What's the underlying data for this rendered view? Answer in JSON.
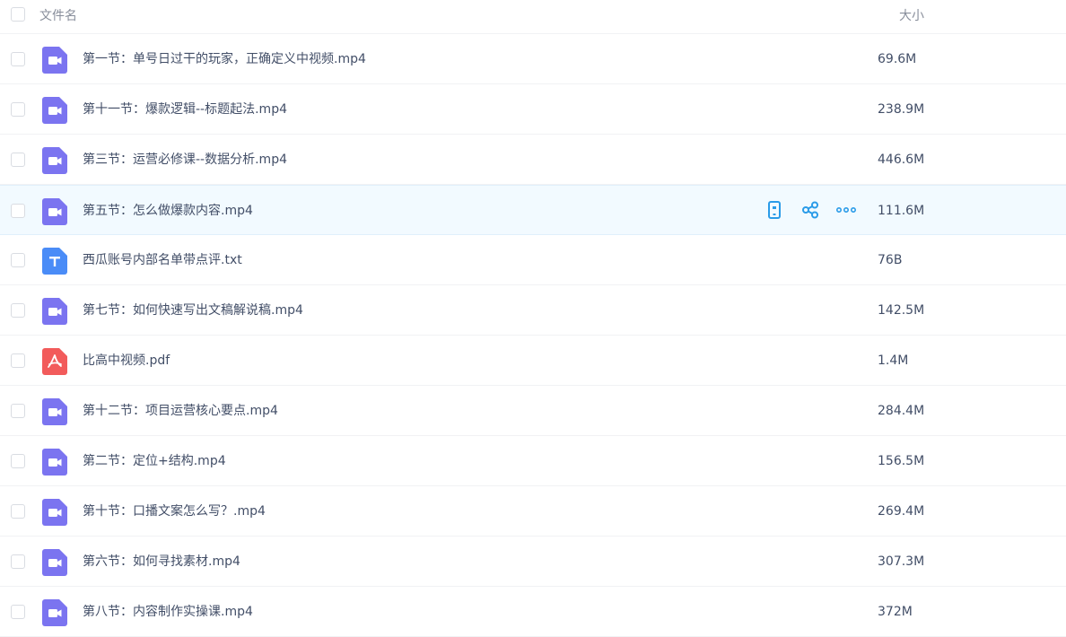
{
  "header": {
    "name_label": "文件名",
    "size_label": "大小"
  },
  "files": [
    {
      "name": "第一节：单号日过干的玩家，正确定义中视频.mp4",
      "size": "69.6M",
      "type": "video"
    },
    {
      "name": "第十一节：爆款逻辑--标题起法.mp4",
      "size": "238.9M",
      "type": "video"
    },
    {
      "name": "第三节：运营必修课--数据分析.mp4",
      "size": "446.6M",
      "type": "video"
    },
    {
      "name": "第五节：怎么做爆款内容.mp4",
      "size": "111.6M",
      "type": "video"
    },
    {
      "name": "西瓜账号内部名单带点评.txt",
      "size": "76B",
      "type": "text"
    },
    {
      "name": "第七节：如何快速写出文稿解说稿.mp4",
      "size": "142.5M",
      "type": "video"
    },
    {
      "name": "比高中视频.pdf",
      "size": "1.4M",
      "type": "pdf"
    },
    {
      "name": "第十二节：项目运营核心要点.mp4",
      "size": "284.4M",
      "type": "video"
    },
    {
      "name": "第二节：定位+结构.mp4",
      "size": "156.5M",
      "type": "video"
    },
    {
      "name": "第十节：口播文案怎么写？.mp4",
      "size": "269.4M",
      "type": "video"
    },
    {
      "name": "第六节：如何寻找素材.mp4",
      "size": "307.3M",
      "type": "video"
    },
    {
      "name": "第八节：内容制作实操课.mp4",
      "size": "372M",
      "type": "video"
    }
  ],
  "hover_row_index": 3,
  "row_actions": [
    "phone-icon",
    "share-icon",
    "more-icon"
  ],
  "colors": {
    "video_icon": "#7b74f0",
    "text_icon": "#4a8cf7",
    "pdf_icon": "#f25b5b",
    "action_icon": "#2a9be8",
    "hover_bg": "#f2faff"
  }
}
